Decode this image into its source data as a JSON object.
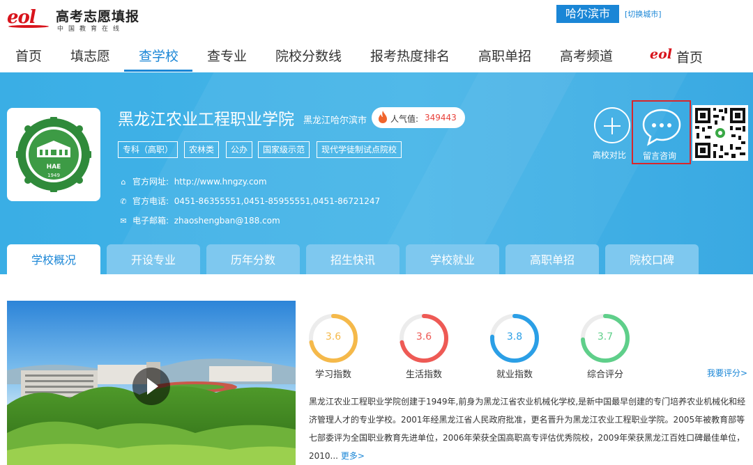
{
  "header": {
    "brand_title": "高考志愿填报",
    "brand_sub": "中国教育在线",
    "city": "哈尔滨市",
    "city_switch": "[切换城市]"
  },
  "nav": {
    "items": [
      "首页",
      "填志愿",
      "查学校",
      "查专业",
      "院校分数线",
      "报考热度排名",
      "高职单招",
      "高考频道"
    ],
    "active": "查学校",
    "eol_home": "首页"
  },
  "school": {
    "name": "黑龙江农业工程职业学院",
    "location": "黑龙江哈尔滨市",
    "popularity_label": "人气值:",
    "popularity_value": "349443",
    "tags": [
      "专科（高职）",
      "农林类",
      "公办",
      "国家级示范",
      "现代学徒制试点院校"
    ],
    "website_label": "官方网址:",
    "website": "http://www.hngzy.com",
    "phone_label": "官方电话:",
    "phone": "0451-86355551,0451-85955551,0451-86721247",
    "email_label": "电子邮箱:",
    "email": "zhaoshengban@188.com",
    "logo_initials": "HAE",
    "logo_year": "1949"
  },
  "actions": {
    "compare": "高校对比",
    "consult": "留言咨询"
  },
  "tabs": [
    "学校概况",
    "开设专业",
    "历年分数",
    "招生快讯",
    "学校就业",
    "高职单招",
    "院校口碑"
  ],
  "ratings": [
    {
      "label": "学习指数",
      "value": "3.6",
      "color": "#f5b94a"
    },
    {
      "label": "生活指数",
      "value": "3.6",
      "color": "#ee5a55"
    },
    {
      "label": "就业指数",
      "value": "3.8",
      "color": "#2b9fe6"
    },
    {
      "label": "综合评分",
      "value": "3.7",
      "color": "#5fcf8a"
    }
  ],
  "my_rating": "我要评分>",
  "description": {
    "text": "黑龙江农业工程职业学院创建于1949年,前身为黑龙江省农业机械化学校,是新中国最早创建的专门培养农业机械化和经济管理人才的专业学校。2001年经黑龙江省人民政府批准，更名晋升为黑龙江农业工程职业学院。2005年被教育部等七部委评为全国职业教育先进单位，2006年荣获全国高职高专评估优秀院校，2009年荣获黑龙江百姓口碑最佳单位，2010...",
    "more": "更多>"
  },
  "colors": {
    "accent": "#1a86d6",
    "banner": "#42b1e6",
    "highlight_border": "#d9262b",
    "brand_red": "#d8141c"
  }
}
